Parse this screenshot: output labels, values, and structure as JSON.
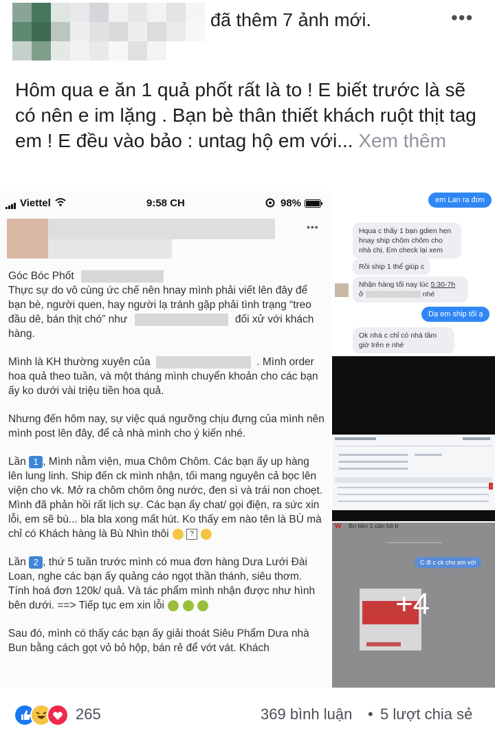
{
  "header": {
    "title": "đã thêm 7 ảnh mới.",
    "more": "•••"
  },
  "caption": {
    "text": "Hôm qua e ăn 1 quả phốt rất là to ! E biết trước là sẽ có nên e im lặng  . Bạn bè thân thiết khách ruột thịt tag em ! E đều vào bảo : untag hộ em với...",
    "see_more": "Xem thêm"
  },
  "screenshot": {
    "status": {
      "carrier": "Viettel",
      "time": "9:58 CH",
      "battery": "98%"
    },
    "more": "•••",
    "page_name": "Góc Bóc Phốt",
    "p1": "Thực sự do vô cùng ức chế nên hnay mình phải viết lên đây để bạn bè, người quen, hay người lạ tránh gặp phải tình trạng “treo đầu dê, bán thịt chó” như",
    "p1_end": "đối xử với khách hàng.",
    "p2_start": "Mình là KH thường xuyên của",
    "p2_end": ". Mình order hoa quả theo tuần, và một tháng mình chuyển khoản cho các bạn ấy ko dưới vài triệu tiền hoa quả.",
    "p3": "Nhưng đến hôm nay, sự việc quá ngưỡng chịu đựng của mình nên mình post lên đây, để cả nhà mình cho ý kiến nhé.",
    "p4_lead": "Lần",
    "p4_badge": "1",
    "p4": ", Mình nằm viện, mua Chôm Chôm. Các bạn ấy up hàng lên lung linh. Ship đến ck mình nhận, tối mang nguyên cả bọc lên viện cho vk. Mở ra chôm chôm ông nước, đen sì và trái non choẹt. Mình đã phản hồi rất lịch sự. Các bạn ấy chat/ gọi điện, ra sức xin lỗi, em sẽ bù... bla bla xong mất hút. Ko thấy em nào tên là BÙ mà chỉ có Khách hàng là Bù Nhìn thôi",
    "p5_lead": "Lần",
    "p5_badge": "2",
    "p5": ", thứ 5 tuần trước mình có mua đơn hàng Dưa Lưới Đài Loan, nghe các bạn ấy quảng cáo ngọt thần thánh, siêu thơm. Tính hoá đơn 120k/ quả. Và tác phẩm mình nhận được như hình bên dưới. ==> Tiếp tục em xin lỗi",
    "p6": "Sau đó, mình có thấy các bạn ấy giải thoát Siêu Phẩm Dưa nhà Bun bằng cách gọt vỏ bỏ hộp, bán rẻ để vớt vát. Khách"
  },
  "chat": {
    "m1": "em Lan ra đơn",
    "m2": "Hqua c thấy 1 bạn gdien hẹn hnay ship chôm chôm cho nhà chị. Em check lại xem",
    "m3": "Rồi ship 1 thể giúp c",
    "m4_a": "Nhận hàng tối nay lúc",
    "m4_time": "5:30-7h",
    "m4_b": "ở",
    "m4_c": "nhé",
    "m5": "Dạ em ship tối ạ",
    "m6": "Ok nhà c chỉ có nhà tầm giờ trên e nhé"
  },
  "thumb4": {
    "top_text": "Bn tiền 1 cần bỏ b",
    "bubble": "C đi c ck cho em với",
    "overlay": "+4"
  },
  "footer": {
    "reactions_count": "265",
    "comments": "369 bình luận",
    "separator": "•",
    "shares": "5 lượt chia sẻ"
  },
  "colors": {
    "link_blue": "#2f87f5",
    "like_blue": "#1877f2",
    "haha_yellow": "#f7c344",
    "love_red": "#f0284a",
    "see_more_gray": "#90949c"
  }
}
